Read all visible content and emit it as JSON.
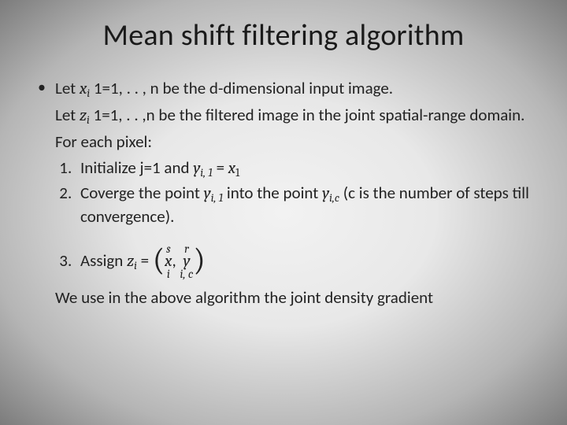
{
  "title": "Mean shift filtering algorithm",
  "line1_prefix": "Let ",
  "line1_var_x": "x",
  "line1_var_sub_i": "i",
  "line1_rest": " 1=1, . . , n be the d-dimensional input image.",
  "line2_prefix": "Let ",
  "line2_var_z": "z",
  "line2_var_sub_i": "i",
  "line2_rest": " 1=1, . . ,n be the filtered image in the joint spatial-range domain.",
  "line3": "For each pixel:",
  "step1_prefix": "Initialize j=1 and ",
  "step1_var_y": "y",
  "step1_sub_i1": "i, 1",
  "step1_eq": " = ",
  "step1_var_x": "x",
  "step1_sub_1": "1",
  "step2_prefix": "Coverge the point ",
  "step2_var_y1": "y",
  "step2_sub_i1": "i, 1",
  "step2_mid": " into the point ",
  "step2_var_y2": "y",
  "step2_sub_ic": "i,c",
  "step2_rest": " (c is the number of steps till convergence).",
  "step3_prefix": "Assign ",
  "step3_var_z": "z",
  "step3_sub_i": "i",
  "step3_eq": " = ",
  "step3_stack1_top": "s",
  "step3_stack1_base": "x",
  "step3_stack1_bot": "i",
  "step3_comma": ", ",
  "step3_stack2_top": "r",
  "step3_stack2_base": "y",
  "step3_stack2_bot": "i, c",
  "closing": "We use in the above algorithm the joint density gradient"
}
